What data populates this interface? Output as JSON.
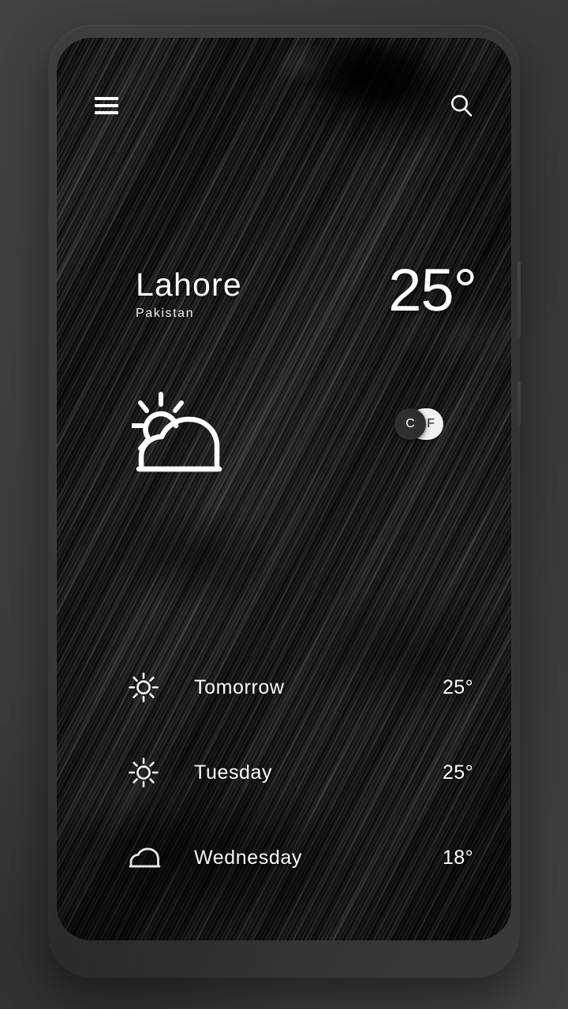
{
  "header": {
    "menu_icon": "hamburger-menu-icon",
    "search_icon": "search-icon"
  },
  "current": {
    "city": "Lahore",
    "country": "Pakistan",
    "temperature": "25°",
    "condition_icon": "sun-behind-cloud-icon"
  },
  "unit_toggle": {
    "celsius_label": "C",
    "fahrenheit_label": "F",
    "selected": "C",
    "active_bg": "#2b2b2b",
    "active_text": "#ffffff",
    "inactive_bg": "#f2f2f2",
    "inactive_text": "#1b1b1b"
  },
  "forecast": {
    "rows": [
      {
        "day": "Tomorrow",
        "temp": "25°",
        "icon": "sun-icon"
      },
      {
        "day": "Tuesday",
        "temp": "25°",
        "icon": "sun-icon"
      },
      {
        "day": "Wednesday",
        "temp": "18°",
        "icon": "cloud-icon"
      }
    ]
  },
  "theme": {
    "text_color": "#ffffff",
    "screen_bg": "#141414",
    "phone_frame": "#383838",
    "page_bg": "#3c3c3c"
  }
}
